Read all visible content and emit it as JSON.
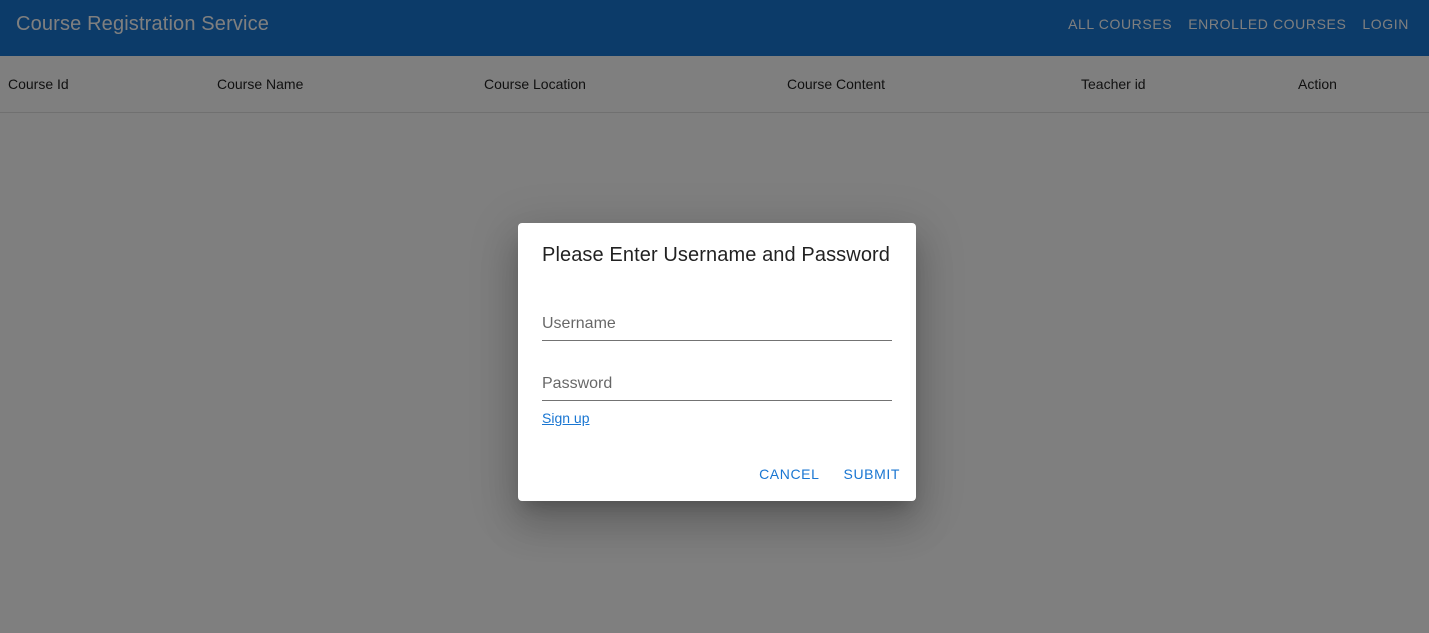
{
  "app": {
    "title": "Course Registration Service",
    "nav": [
      "ALL COURSES",
      "ENROLLED COURSES",
      "LOGIN"
    ]
  },
  "table": {
    "headers": [
      "Course Id",
      "Course Name",
      "Course Location",
      "Course Content",
      "Teacher id",
      "Action"
    ]
  },
  "dialog": {
    "title": "Please Enter Username and Password",
    "username_placeholder": "Username",
    "username_value": "",
    "password_placeholder": "Password",
    "password_value": "",
    "signup_label": "Sign up",
    "cancel_label": "CANCEL",
    "submit_label": "SUBMIT"
  },
  "colors": {
    "primary": "#1976d2",
    "backdrop": "rgba(0,0,0,0.5)"
  }
}
